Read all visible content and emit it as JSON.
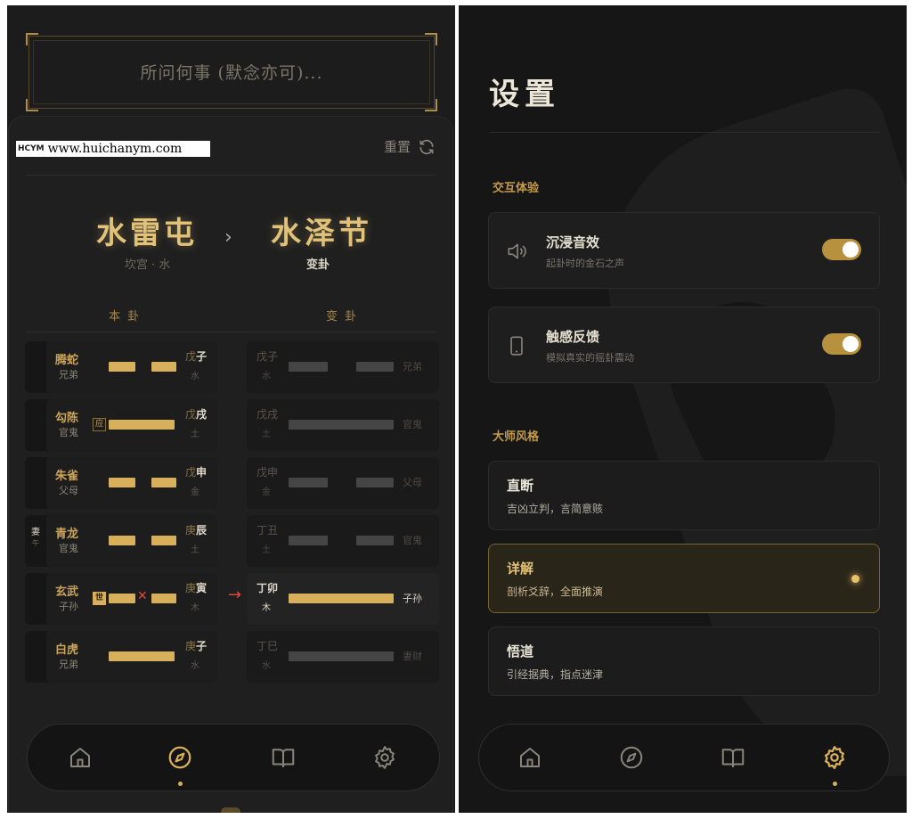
{
  "divination": {
    "question_placeholder": "所问何事 (默念亦可)...",
    "watermark": {
      "logo": "HCYM",
      "url": "www.huichanym.com"
    },
    "reset_label": "重置",
    "main_hexagram": {
      "name": "水雷屯",
      "palace": "坎宫 · 水"
    },
    "changed_hexagram": {
      "name": "水泽节",
      "label": "变卦"
    },
    "columns": {
      "main": "本 卦",
      "changed": "变 卦"
    },
    "rows": [
      {
        "beast": "腾蛇",
        "relation": "兄弟",
        "stem": "戊",
        "branch": "子",
        "element": "水",
        "c_stem_branch": "戊子",
        "c_element": "水",
        "c_relation": "兄弟"
      },
      {
        "beast": "勾陈",
        "relation": "官鬼",
        "tag": "应",
        "stem": "戊",
        "branch": "戌",
        "element": "土",
        "c_stem_branch": "戊戌",
        "c_element": "土",
        "c_relation": "官鬼"
      },
      {
        "beast": "朱雀",
        "relation": "父母",
        "stem": "戊",
        "branch": "申",
        "element": "金",
        "c_stem_branch": "戊申",
        "c_element": "金",
        "c_relation": "父母"
      },
      {
        "beast": "青龙",
        "relation": "官鬼",
        "shi": "妻",
        "shi_sub": "午",
        "stem": "庚",
        "branch": "辰",
        "element": "土",
        "c_stem_branch": "丁丑",
        "c_element": "土",
        "c_relation": "官鬼"
      },
      {
        "beast": "玄武",
        "relation": "子孙",
        "tag": "世",
        "stem": "庚",
        "branch": "寅",
        "element": "木",
        "c_stem_branch": "丁卯",
        "c_element": "木",
        "c_relation": "子孙"
      },
      {
        "beast": "白虎",
        "relation": "兄弟",
        "stem": "庚",
        "branch": "子",
        "element": "水",
        "c_stem_branch": "丁巳",
        "c_element": "水",
        "c_relation": "妻财"
      }
    ]
  },
  "settings": {
    "title": "设置",
    "interaction_section": "交互体验",
    "sound": {
      "label": "沉浸音效",
      "desc": "起卦时的金石之声",
      "enabled": true
    },
    "haptic": {
      "label": "触感反馈",
      "desc": "模拟真实的摇卦震动",
      "enabled": true
    },
    "style_section": "大师风格",
    "styles": [
      {
        "name": "直断",
        "desc": "吉凶立判，言简意赅",
        "selected": false
      },
      {
        "name": "详解",
        "desc": "剖析爻辞，全面推演",
        "selected": true
      },
      {
        "name": "悟道",
        "desc": "引经据典，指点迷津",
        "selected": false
      }
    ]
  },
  "navigation": {
    "items": [
      "home-icon",
      "compass-icon",
      "book-icon",
      "gear-icon"
    ],
    "left_active": "compass-icon",
    "right_active": "gear-icon"
  },
  "colors": {
    "accent": "#d8b05c",
    "background": "#1c1c1c",
    "change_marker": "#d94a3a",
    "inactive_line": "#454545"
  }
}
